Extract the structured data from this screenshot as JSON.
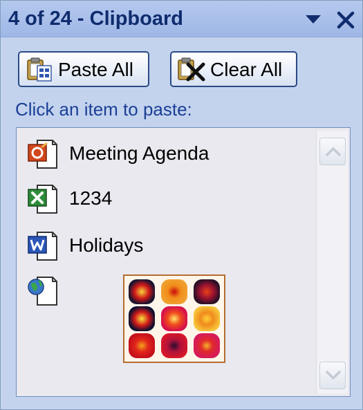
{
  "pane": {
    "title": "4 of 24 - Clipboard"
  },
  "toolbar": {
    "paste_all_label": "Paste All",
    "clear_all_label": "Clear All"
  },
  "instruction": "Click an item to paste:",
  "items": [
    {
      "label": "Meeting Agenda",
      "icon": "outlook-file-icon"
    },
    {
      "label": "1234",
      "icon": "excel-file-icon"
    },
    {
      "label": "Holidays",
      "icon": "word-file-icon"
    },
    {
      "label": "",
      "icon": "image-file-icon"
    }
  ],
  "colors": {
    "title_text": "#0f2c6e",
    "instruction_text": "#1b3f96",
    "pane_bg": "#c3d3ee",
    "list_bg": "#e9e9ef"
  }
}
